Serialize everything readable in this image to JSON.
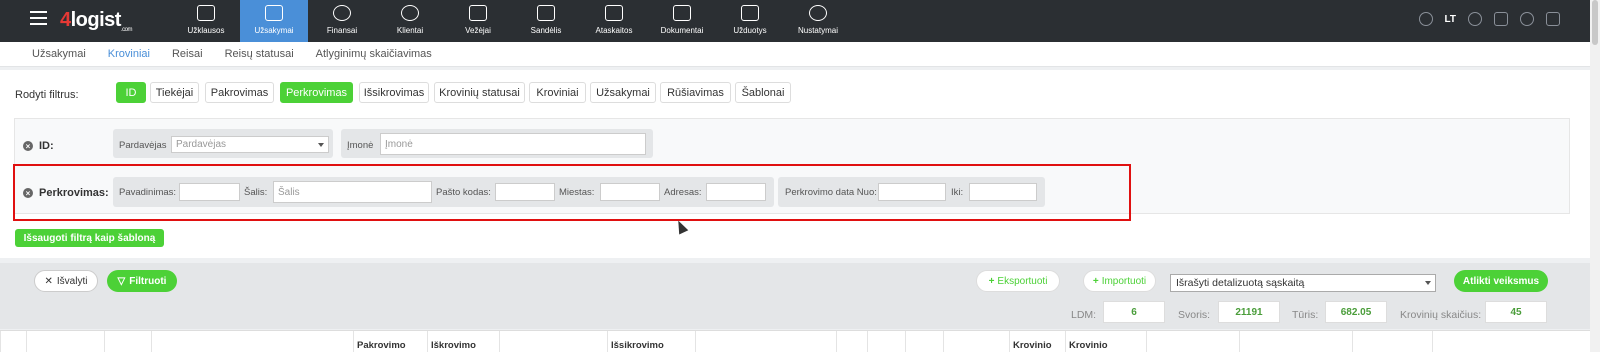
{
  "topnav": {
    "logo": "4logist",
    "logo_sub": ".com",
    "items": [
      {
        "label": "Užklausos",
        "icon": "chat-icon"
      },
      {
        "label": "Užsakymai",
        "icon": "cart-icon"
      },
      {
        "label": "Finansai",
        "icon": "money-bag-icon"
      },
      {
        "label": "Klientai",
        "icon": "users-icon"
      },
      {
        "label": "Vežėjai",
        "icon": "truck-icon"
      },
      {
        "label": "Sandėlis",
        "icon": "warehouse-icon"
      },
      {
        "label": "Ataskaitos",
        "icon": "calculator-icon"
      },
      {
        "label": "Dokumentai",
        "icon": "document-icon"
      },
      {
        "label": "Užduotys",
        "icon": "calendar-icon"
      },
      {
        "label": "Nustatymai",
        "icon": "gear-icon"
      }
    ],
    "active_index": 1,
    "lang": "LT"
  },
  "subnav": {
    "items": [
      "Užsakymai",
      "Kroviniai",
      "Reisai",
      "Reisų statusai",
      "Atlyginimų skaičiavimas"
    ],
    "active_index": 1
  },
  "filters": {
    "show_label": "Rodyti filtrus:",
    "chips": [
      {
        "label": "ID",
        "active": true
      },
      {
        "label": "Tiekėjai",
        "active": false
      },
      {
        "label": "Pakrovimas",
        "active": false
      },
      {
        "label": "Perkrovimas",
        "active": true
      },
      {
        "label": "Išsikrovimas",
        "active": false
      },
      {
        "label": "Krovinių statusai",
        "active": false
      },
      {
        "label": "Kroviniai",
        "active": false
      },
      {
        "label": "Užsakymai",
        "active": false
      },
      {
        "label": "Rūšiavimas",
        "active": false
      },
      {
        "label": "Šablonai",
        "active": false
      }
    ],
    "id_row": {
      "label": "ID:",
      "seller_label": "Pardavėjas",
      "seller_placeholder": "Pardavėjas",
      "company_label": "Įmonė",
      "company_placeholder": "Įmonė"
    },
    "transship_row": {
      "label": "Perkrovimas:",
      "name_label": "Pavadinimas:",
      "country_label": "Šalis:",
      "country_placeholder": "Šalis",
      "postal_label": "Pašto kodas:",
      "city_label": "Miestas:",
      "address_label": "Adresas:",
      "date_from_label": "Perkrovimo data Nuo:",
      "date_to_label": "Iki:"
    },
    "save_template": "Išsaugoti filtrą kaip šabloną"
  },
  "toolbar": {
    "clear": "Išvalyti",
    "filter": "Filtruoti",
    "export": "Eksportuoti",
    "import": "Importuoti",
    "invoice_select": "Išrašyti detalizuotą sąskaitą",
    "perform_action": "Atlikti veiksmus",
    "stats": {
      "ldm_label": "LDM:",
      "ldm_value": "6",
      "weight_label": "Svoris:",
      "weight_value": "21191",
      "volume_label": "Tūris:",
      "volume_value": "682.05",
      "count_label": "Krovinių skaičius:",
      "count_value": "45"
    }
  },
  "table": {
    "headers": [
      "",
      "",
      "",
      "Pakrovimo",
      "Iškrovimo",
      "",
      "Išsikrovimo",
      "",
      "",
      "",
      "",
      "",
      "Krovinio",
      "Krovinio",
      "",
      "",
      "",
      ""
    ]
  }
}
